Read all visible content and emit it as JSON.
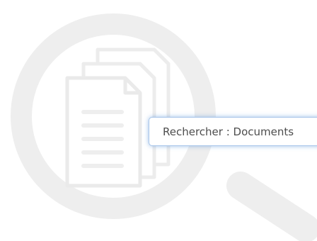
{
  "search": {
    "label": "Rechercher : Documents"
  },
  "icons": {
    "background": "magnifier-documents-watermark-icon"
  },
  "colors": {
    "watermark": "#eeeeee",
    "field_border": "#a9c6ea",
    "field_glow": "#508cd7",
    "text": "#4d4d4d"
  }
}
